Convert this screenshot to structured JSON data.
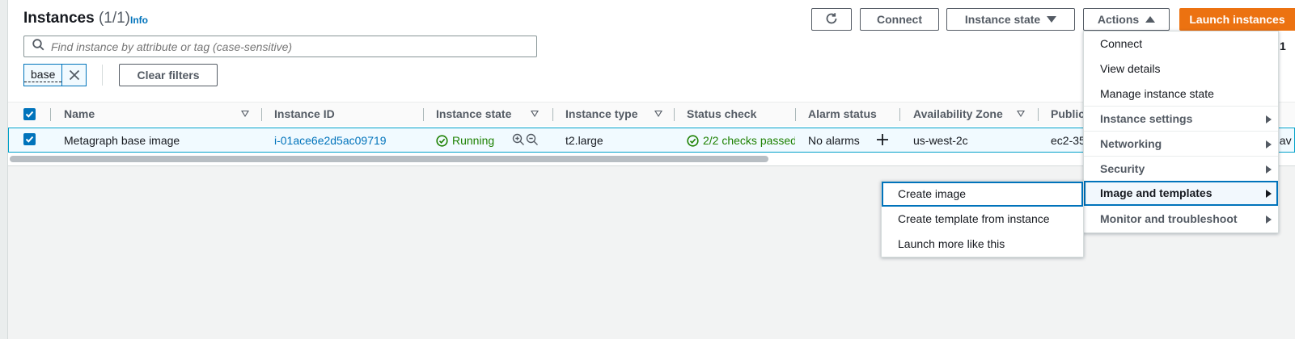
{
  "header": {
    "title": "Instances",
    "count": "(1/1)",
    "info_label": "Info"
  },
  "toolbar": {
    "connect_label": "Connect",
    "instance_state_label": "Instance state",
    "actions_label": "Actions",
    "launch_label": "Launch instances"
  },
  "search": {
    "placeholder": "Find instance by attribute or tag (case-sensitive)"
  },
  "filters": {
    "token_label": "base",
    "clear_label": "Clear filters"
  },
  "table": {
    "columns": [
      "Name",
      "Instance ID",
      "Instance state",
      "Instance type",
      "Status check",
      "Alarm status",
      "Availability Zone",
      "Public"
    ],
    "rows": [
      {
        "name": "Metagraph base image",
        "instance_id": "i-01ace6e2d5ac09719",
        "state": "Running",
        "type": "t2.large",
        "status_check": "2/2 checks passed",
        "alarm": "No alarms",
        "az": "us-west-2c",
        "public": "ec2-35",
        "overflow": "nav"
      }
    ]
  },
  "actions_menu": {
    "items": [
      {
        "label": "Connect"
      },
      {
        "label": "View details"
      },
      {
        "label": "Manage instance state"
      },
      {
        "label": "Instance settings"
      },
      {
        "label": "Networking"
      },
      {
        "label": "Security"
      },
      {
        "label": "Image and templates"
      },
      {
        "label": "Monitor and troubleshoot"
      }
    ],
    "page_fragment": "1"
  },
  "image_submenu": {
    "items": [
      {
        "label": "Create image"
      },
      {
        "label": "Create template from instance"
      },
      {
        "label": "Launch more like this"
      }
    ]
  },
  "colors": {
    "primary": "#ec7211",
    "link": "#0073bb",
    "success": "#1d8102"
  }
}
